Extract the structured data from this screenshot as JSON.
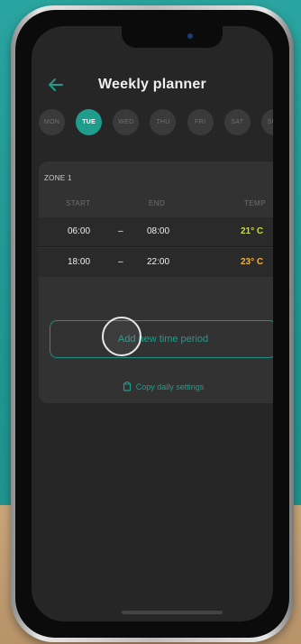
{
  "header": {
    "title": "Weekly planner"
  },
  "days": [
    {
      "label": "MON",
      "active": false
    },
    {
      "label": "TUE",
      "active": true
    },
    {
      "label": "WED",
      "active": false
    },
    {
      "label": "THU",
      "active": false
    },
    {
      "label": "FRI",
      "active": false
    },
    {
      "label": "SAT",
      "active": false
    },
    {
      "label": "SUN",
      "active": false
    }
  ],
  "zone": {
    "title": "ZONE 1",
    "columns": {
      "start": "START",
      "end": "END",
      "temp": "TEMP"
    },
    "periods": [
      {
        "start": "06:00",
        "dash": "–",
        "end": "08:00",
        "temp": "21° C",
        "temp_color": "#cddc39"
      },
      {
        "start": "18:00",
        "dash": "–",
        "end": "22:00",
        "temp": "23° C",
        "temp_color": "#f2b233"
      }
    ]
  },
  "actions": {
    "add_label": "Add new time period",
    "copy_label": "Copy daily settings"
  },
  "colors": {
    "accent": "#1f9d8c",
    "background": "#262626",
    "card": "#323232"
  }
}
